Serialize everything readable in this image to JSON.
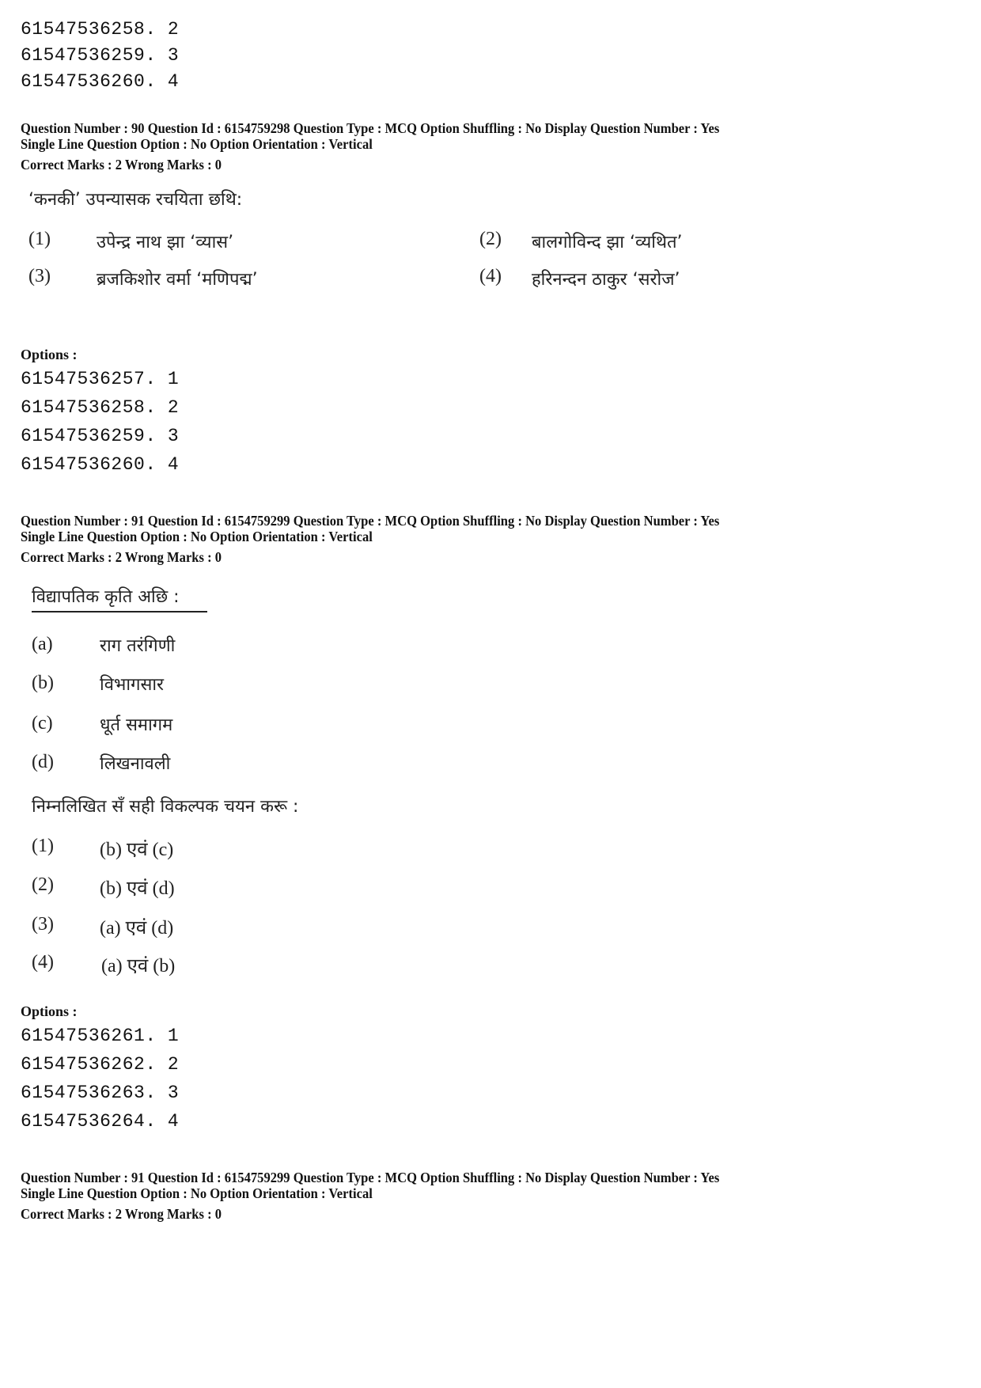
{
  "prev_options_tail": [
    "61547536258. 2",
    "61547536259. 3",
    "61547536260. 4"
  ],
  "questions": [
    {
      "meta_line1": "Question Number : 90  Question Id : 6154759298  Question Type : MCQ  Option Shuffling : No  Display Question Number : Yes",
      "meta_line2": "Single Line Question Option : No  Option Orientation : Vertical",
      "marks": "Correct Marks : 2  Wrong Marks : 0",
      "stem": "‘कनकी’ उपन्यासक रचयिता छथि:",
      "choices": [
        {
          "num": "(1)",
          "text": "उपेन्द्र नाथ झा ‘व्यास’"
        },
        {
          "num": "(2)",
          "text": "बालगोविन्द झा ‘व्यथित’"
        },
        {
          "num": "(3)",
          "text": "ब्रजकिशोर वर्मा ‘मणिपद्म’"
        },
        {
          "num": "(4)",
          "text": "हरिनन्दन ठाकुर ‘सरोज’"
        }
      ],
      "options_label": "Options :",
      "options": [
        "61547536257. 1",
        "61547536258. 2",
        "61547536259. 3",
        "61547536260. 4"
      ]
    },
    {
      "meta_line1": "Question Number : 91  Question Id : 6154759299  Question Type : MCQ  Option Shuffling : No  Display Question Number : Yes",
      "meta_line2": "Single Line Question Option : No  Option Orientation : Vertical",
      "marks": "Correct Marks : 2  Wrong Marks : 0",
      "stem": "विद्यापतिक कृति अछि :",
      "items": [
        {
          "num": "(a)",
          "text": "राग तरंगिणी"
        },
        {
          "num": "(b)",
          "text": "विभागसार"
        },
        {
          "num": "(c)",
          "text": "धूर्त समागम"
        },
        {
          "num": "(d)",
          "text": "लिखनावली"
        }
      ],
      "instruction": "निम्नलिखित सँ सही विकल्पक चयन करू :",
      "choices": [
        {
          "num": "(1)",
          "text": "(b) एवं (c)"
        },
        {
          "num": "(2)",
          "text": "(b) एवं (d)"
        },
        {
          "num": "(3)",
          "text": "(a) एवं (d)"
        },
        {
          "num": "(4)",
          "text": "(a) एवं (b)"
        }
      ],
      "options_label": "Options :",
      "options": [
        "61547536261. 1",
        "61547536262. 2",
        "61547536263. 3",
        "61547536264. 4"
      ]
    },
    {
      "meta_line1": "Question Number : 91  Question Id : 6154759299  Question Type : MCQ  Option Shuffling : No  Display Question Number : Yes",
      "meta_line2": "Single Line Question Option : No  Option Orientation : Vertical",
      "marks": "Correct Marks : 2  Wrong Marks : 0"
    }
  ]
}
